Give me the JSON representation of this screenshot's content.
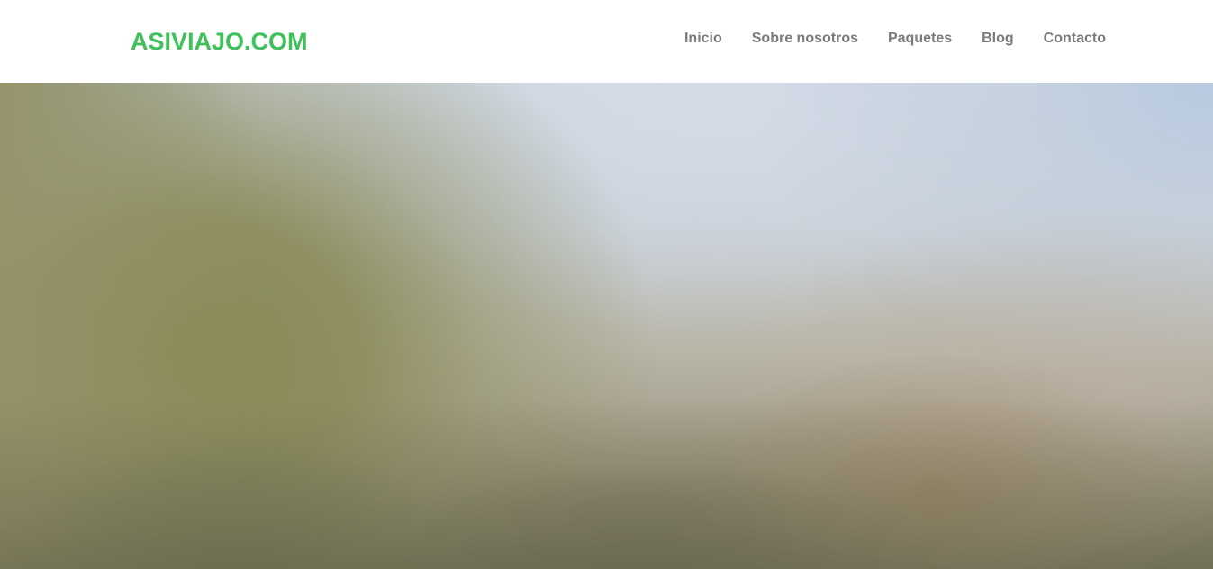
{
  "header": {
    "logo": "ASIVIAJO.COM",
    "nav": [
      {
        "label": "Inicio"
      },
      {
        "label": "Sobre nosotros"
      },
      {
        "label": "Paquetes"
      },
      {
        "label": "Blog"
      },
      {
        "label": "Contacto"
      }
    ]
  },
  "colors": {
    "brand": "#3fc05b",
    "nav_text": "#7b7b7b",
    "header_bg": "#ffffff"
  },
  "hero": {
    "image": "blurred-landscape-background"
  }
}
